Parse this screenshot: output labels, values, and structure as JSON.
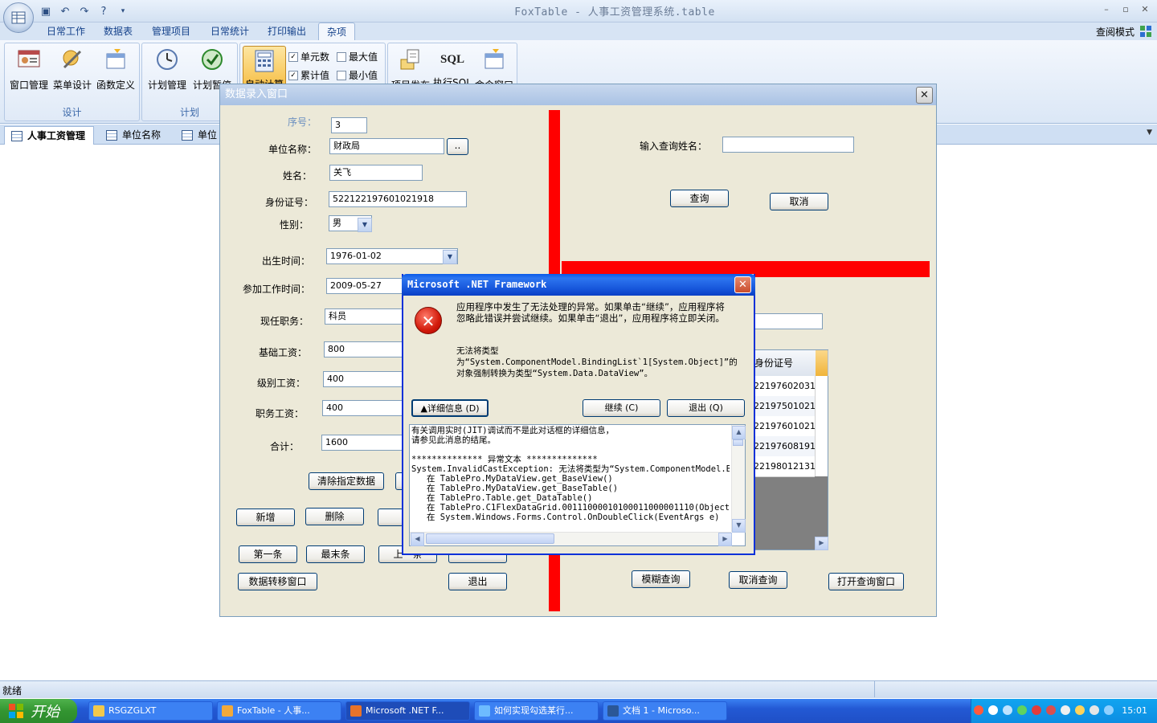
{
  "app": {
    "title": "FoxTable - 人事工资管理系统.table",
    "view_mode": "查阅模式",
    "ribbon_tabs": [
      "日常工作",
      "数据表",
      "管理项目",
      "日常统计",
      "打印输出",
      "杂项"
    ],
    "ribbon": {
      "design": {
        "label": "设计",
        "buttons": [
          "窗口管理",
          "菜单设计",
          "函数定义"
        ]
      },
      "plan": {
        "label": "计划",
        "buttons": [
          "计划管理",
          "计划暂停"
        ]
      },
      "calc": {
        "auto_calc": "自动计算",
        "cell_count": "单元数",
        "max": "最大值",
        "cumulative": "累计值",
        "min": "最小值"
      },
      "misc": {
        "buttons": [
          "项目发布",
          "执行SQL",
          "命令窗口"
        ],
        "sql_badge": "SQL"
      }
    },
    "doc_tabs": [
      "人事工资管理",
      "单位名称",
      "单位"
    ],
    "status": "就绪"
  },
  "entry_window": {
    "title": "数据录入窗口",
    "fields": {
      "seq_label": "序号：",
      "seq_value": "3",
      "unit_label": "单位名称：",
      "unit_value": "财政局",
      "unit_browse": "..",
      "name_label": "姓名：",
      "name_value": "关飞",
      "id_label": "身份证号：",
      "id_value": "522122197601021918",
      "gender_label": "性别：",
      "gender_value": "男",
      "birth_label": "出生时间：",
      "birth_value": "1976-01-02",
      "work_label": "参加工作时间：",
      "work_value": "2009-05-27",
      "post_label": "现任职务：",
      "post_value": "科员",
      "base_label": "基础工资：",
      "base_value": "800",
      "level_label": "级别工资：",
      "level_value": "400",
      "duty_label": "职务工资：",
      "duty_value": "400",
      "total_label": "合计：",
      "total_value": "1600"
    },
    "buttons": {
      "clear": "清除指定数据",
      "add": "新增",
      "delete": "删除",
      "first": "第一条",
      "last": "最末条",
      "prev": "上一条",
      "transfer": "数据转移窗口",
      "exit": "退出"
    },
    "query": {
      "label": "输入查询姓名：",
      "search": "查询",
      "cancel": "取消",
      "fuzzy": "模糊查询",
      "cancel_query": "取消查询",
      "open_window": "打开查询窗口"
    },
    "grid": {
      "header": "身份证号",
      "rows": [
        "22197602031",
        "22197501021",
        "22197601021",
        "22197608191",
        "22198012131"
      ]
    }
  },
  "error_dialog": {
    "title": "Microsoft .NET Framework",
    "message1": "应用程序中发生了无法处理的异常。如果单击“继续”，应用程序将忽略此错误并尝试继续。如果单击“退出”，应用程序将立即关闭。",
    "message2": "无法将类型为“System.ComponentModel.BindingList`1[System.Object]”的对象强制转换为类型“System.Data.DataView”。",
    "details_btn": "▲详细信息 (D)",
    "continue_btn": "继续 (C)",
    "quit_btn": "退出 (Q)",
    "details_text": "有关调用实时(JIT)调试而不是此对话框的详细信息，\n请参见此消息的结尾。\n\n************** 异常文本 **************\nSystem.InvalidCastException: 无法将类型为“System.ComponentModel.B\n   在 TablePro.MyDataView.get_BaseView()\n   在 TablePro.MyDataView.get_BaseTable()\n   在 TablePro.Table.get_DataTable()\n   在 TablePro.C1FlexDataGrid.00111000010100011000001110(Object 01\n   在 System.Windows.Forms.Control.OnDoubleClick(EventArgs e)"
  },
  "taskbar": {
    "start": "开始",
    "items": [
      "RSGZGLXT",
      "FoxTable - 人事...",
      "Microsoft .NET F...",
      "如何实现勾选某行...",
      "文档 1 - Microso..."
    ],
    "clock": "15:01"
  },
  "colors": {
    "accent": "#15428b",
    "error_title": "#0a5ae8",
    "red_bar": "#ff0000",
    "taskbar": "#245fd8"
  }
}
